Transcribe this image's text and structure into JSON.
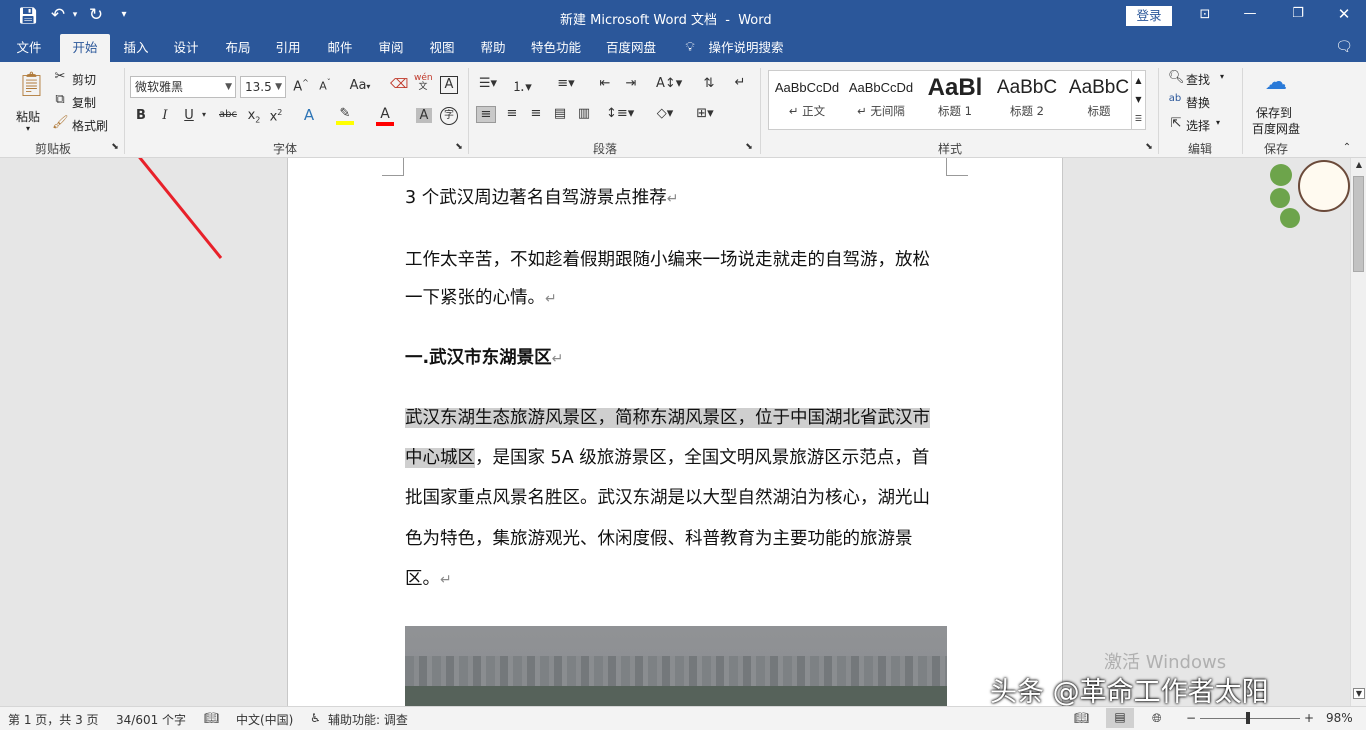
{
  "titlebar": {
    "title": "新建 Microsoft Word 文档  -  Word",
    "login_label": "登录"
  },
  "tabs": [
    "文件",
    "开始",
    "插入",
    "设计",
    "布局",
    "引用",
    "邮件",
    "审阅",
    "视图",
    "帮助",
    "特色功能",
    "百度网盘"
  ],
  "search_label": "操作说明搜索",
  "clipboard": {
    "paste": "粘贴",
    "cut": "剪切",
    "copy": "复制",
    "format_painter": "格式刷",
    "group": "剪贴板"
  },
  "font": {
    "name": "微软雅黑",
    "size": "13.5",
    "group": "字体",
    "case": "Aa",
    "phonetic": "wén"
  },
  "paragraph": {
    "group": "段落"
  },
  "styles": {
    "group": "样式",
    "items": [
      {
        "sample": "AaBbCcDd",
        "label": "↵ 正文"
      },
      {
        "sample": "AaBbCcDd",
        "label": "↵ 无间隔"
      },
      {
        "sample": "AaBl",
        "label": "标题 1"
      },
      {
        "sample": "AaBbC",
        "label": "标题 2"
      },
      {
        "sample": "AaBbC",
        "label": "标题"
      }
    ]
  },
  "editing": {
    "find": "查找",
    "replace": "替换",
    "select": "选择",
    "group": "编辑"
  },
  "save": {
    "label_line1": "保存到",
    "label_line2": "百度网盘",
    "group": "保存"
  },
  "document": {
    "title_line": "3 个武汉周边著名自驾游景点推荐",
    "intro_1": "工作太辛苦，不如趁着假期跟随小编来一场说走就走的自驾游，放松",
    "intro_2": "一下紧张的心情。",
    "heading": "一.武汉市东湖景区",
    "body_1": "武汉东湖生态旅游风景区，简称东湖风景区，位于中国湖北省武汉市",
    "body_2a": "中心城区",
    "body_2b": "，是国家 5A 级旅游景区，全国文明风景旅游区示范点，首",
    "body_3": "批国家重点风景名胜区。武汉东湖是以大型自然湖泊为核心，湖光山",
    "body_4": "色为特色，集旅游观光、休闲度假、科普教育为主要功能的旅游景",
    "body_5": "区。",
    "para_mark": "↵"
  },
  "watermark": {
    "activate": "激活 Windows",
    "credit": "头条 @革命工作者太阳"
  },
  "statusbar": {
    "page": "第 1 页，共 3 页",
    "words": "34/601 个字",
    "lang": "中文(中国)",
    "accessibility": "辅助功能: 调查",
    "zoom": "98%"
  }
}
